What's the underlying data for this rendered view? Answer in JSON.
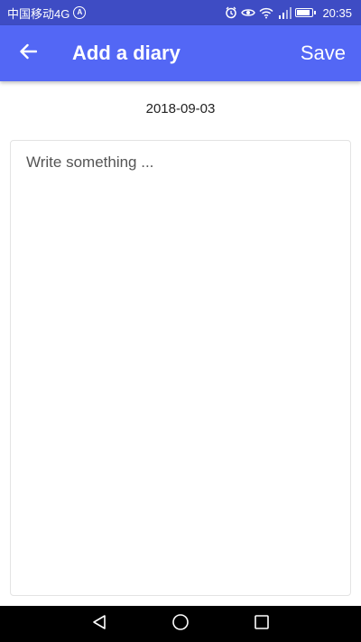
{
  "status_bar": {
    "carrier": "中国移动4G",
    "carrier_badge": "A",
    "time": "20:35",
    "battery_level": 0.85,
    "icons": [
      "alarm-icon",
      "eye-icon",
      "wifi-icon",
      "signal-icon",
      "battery-icon"
    ]
  },
  "app_bar": {
    "title": "Add a diary",
    "save_label": "Save",
    "back_icon": "arrow-left-icon",
    "background_color": "#5367f5"
  },
  "diary": {
    "date": "2018-09-03",
    "placeholder": "Write something ...",
    "value": ""
  },
  "nav_bar": {
    "icons": [
      "back-triangle-icon",
      "home-circle-icon",
      "recents-square-icon"
    ]
  }
}
